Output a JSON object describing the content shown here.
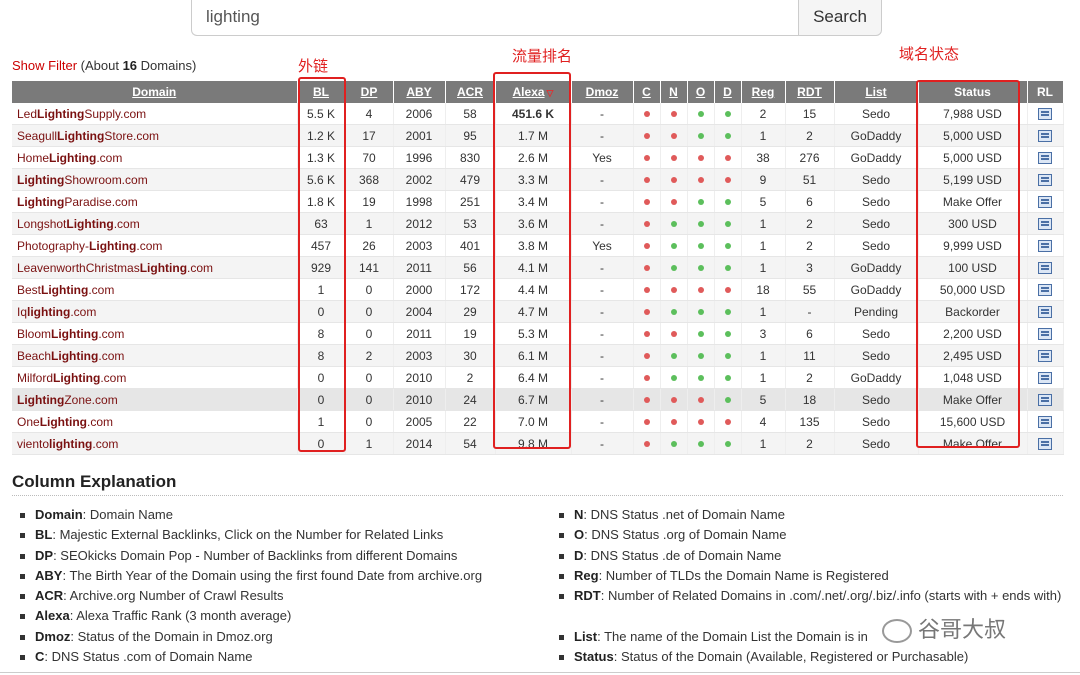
{
  "search": {
    "value": "lighting",
    "button_label": "Search"
  },
  "summary": {
    "show_filter": "Show Filter",
    "prefix": "(About ",
    "count": "16",
    "suffix": " Domains)"
  },
  "annotations": {
    "bl": "外链",
    "alexa": "流量排名",
    "status": "域名状态"
  },
  "columns": [
    "Domain",
    "BL",
    "DP",
    "ABY",
    "ACR",
    "Alexa",
    "Dmoz",
    "C",
    "N",
    "O",
    "D",
    "Reg",
    "RDT",
    "List",
    "Status",
    "RL"
  ],
  "rows": [
    {
      "pre": "Led",
      "kw": "Lighting",
      "post": "Supply.com",
      "bl": "5.5 K",
      "dp": "4",
      "aby": "2006",
      "acr": "58",
      "alexa": "451.6 K",
      "dmoz": "-",
      "c": "red",
      "n": "red",
      "o": "green",
      "d": "green",
      "reg": "2",
      "rdt": "15",
      "list": "Sedo",
      "status": "7,988 USD",
      "status_color": "green"
    },
    {
      "pre": "Seagull",
      "kw": "Lighting",
      "post": "Store.com",
      "bl": "1.2 K",
      "dp": "17",
      "aby": "2001",
      "acr": "95",
      "alexa": "1.7 M",
      "dmoz": "-",
      "c": "red",
      "n": "red",
      "o": "green",
      "d": "green",
      "reg": "1",
      "rdt": "2",
      "list": "GoDaddy",
      "status": "5,000 USD",
      "status_color": "orange"
    },
    {
      "pre": "Home",
      "kw": "Lighting",
      "post": ".com",
      "bl": "1.3 K",
      "dp": "70",
      "aby": "1996",
      "acr": "830",
      "alexa": "2.6 M",
      "dmoz": "Yes",
      "c": "red",
      "n": "red",
      "o": "red",
      "d": "red",
      "reg": "38",
      "rdt": "276",
      "list": "GoDaddy",
      "status": "5,000 USD",
      "status_color": "orange"
    },
    {
      "pre": "",
      "kw": "Lighting",
      "post": "Showroom.com",
      "bl": "5.6 K",
      "dp": "368",
      "aby": "2002",
      "acr": "479",
      "alexa": "3.3 M",
      "dmoz": "-",
      "c": "red",
      "n": "red",
      "o": "red",
      "d": "red",
      "reg": "9",
      "rdt": "51",
      "list": "Sedo",
      "status": "5,199 USD",
      "status_color": "orange"
    },
    {
      "pre": "",
      "kw": "Lighting",
      "post": "Paradise.com",
      "bl": "1.8 K",
      "dp": "19",
      "aby": "1998",
      "acr": "251",
      "alexa": "3.4 M",
      "dmoz": "-",
      "c": "red",
      "n": "red",
      "o": "green",
      "d": "green",
      "reg": "5",
      "rdt": "6",
      "list": "Sedo",
      "status": "Make Offer",
      "status_color": "orange"
    },
    {
      "pre": "Longshot",
      "kw": "Lighting",
      "post": ".com",
      "bl": "63",
      "dp": "1",
      "aby": "2012",
      "acr": "53",
      "alexa": "3.6 M",
      "dmoz": "-",
      "c": "red",
      "n": "green",
      "o": "green",
      "d": "green",
      "reg": "1",
      "rdt": "2",
      "list": "Sedo",
      "status": "300 USD",
      "status_color": "green"
    },
    {
      "pre": "Photography-",
      "kw": "Lighting",
      "post": ".com",
      "bl": "457",
      "dp": "26",
      "aby": "2003",
      "acr": "401",
      "alexa": "3.8 M",
      "dmoz": "Yes",
      "c": "red",
      "n": "green",
      "o": "green",
      "d": "green",
      "reg": "1",
      "rdt": "2",
      "list": "Sedo",
      "status": "9,999 USD",
      "status_color": "green"
    },
    {
      "pre": "LeavenworthChristmas",
      "kw": "Lighting",
      "post": ".com",
      "bl": "929",
      "dp": "141",
      "aby": "2011",
      "acr": "56",
      "alexa": "4.1 M",
      "dmoz": "-",
      "c": "red",
      "n": "green",
      "o": "green",
      "d": "green",
      "reg": "1",
      "rdt": "3",
      "list": "GoDaddy",
      "status": "100 USD",
      "status_color": "orange"
    },
    {
      "pre": "Best",
      "kw": "Lighting",
      "post": ".com",
      "bl": "1",
      "dp": "0",
      "aby": "2000",
      "acr": "172",
      "alexa": "4.4 M",
      "dmoz": "-",
      "c": "red",
      "n": "red",
      "o": "red",
      "d": "red",
      "reg": "18",
      "rdt": "55",
      "list": "GoDaddy",
      "status": "50,000 USD",
      "status_color": "orange"
    },
    {
      "pre": "Iq",
      "kw": "lighting",
      "post": ".com",
      "bl": "0",
      "dp": "0",
      "aby": "2004",
      "acr": "29",
      "alexa": "4.7 M",
      "dmoz": "-",
      "c": "red",
      "n": "green",
      "o": "green",
      "d": "green",
      "reg": "1",
      "rdt": "-",
      "list": "Pending",
      "status": "Backorder",
      "status_color": "plain"
    },
    {
      "pre": "Bloom",
      "kw": "Lighting",
      "post": ".com",
      "bl": "8",
      "dp": "0",
      "aby": "2011",
      "acr": "19",
      "alexa": "5.3 M",
      "dmoz": "-",
      "c": "red",
      "n": "red",
      "o": "green",
      "d": "green",
      "reg": "3",
      "rdt": "6",
      "list": "Sedo",
      "status": "2,200 USD",
      "status_color": "green"
    },
    {
      "pre": "Beach",
      "kw": "Lighting",
      "post": ".com",
      "bl": "8",
      "dp": "2",
      "aby": "2003",
      "acr": "30",
      "alexa": "6.1 M",
      "dmoz": "-",
      "c": "red",
      "n": "green",
      "o": "green",
      "d": "green",
      "reg": "1",
      "rdt": "11",
      "list": "Sedo",
      "status": "2,495 USD",
      "status_color": "orange"
    },
    {
      "pre": "Milford",
      "kw": "Lighting",
      "post": ".com",
      "bl": "0",
      "dp": "0",
      "aby": "2010",
      "acr": "2",
      "alexa": "6.4 M",
      "dmoz": "-",
      "c": "red",
      "n": "green",
      "o": "green",
      "d": "green",
      "reg": "1",
      "rdt": "2",
      "list": "GoDaddy",
      "status": "1,048 USD",
      "status_color": "green"
    },
    {
      "pre": "",
      "kw": "Lighting",
      "post": "Zone.com",
      "bl": "0",
      "dp": "0",
      "aby": "2010",
      "acr": "24",
      "alexa": "6.7 M",
      "dmoz": "-",
      "c": "red",
      "n": "red",
      "o": "red",
      "d": "green",
      "reg": "5",
      "rdt": "18",
      "list": "Sedo",
      "status": "Make Offer",
      "status_color": "orange"
    },
    {
      "pre": "One",
      "kw": "Lighting",
      "post": ".com",
      "bl": "1",
      "dp": "0",
      "aby": "2005",
      "acr": "22",
      "alexa": "7.0 M",
      "dmoz": "-",
      "c": "red",
      "n": "red",
      "o": "red",
      "d": "red",
      "reg": "4",
      "rdt": "135",
      "list": "Sedo",
      "status": "15,600 USD",
      "status_color": "green"
    },
    {
      "pre": "viento",
      "kw": "lighting",
      "post": ".com",
      "bl": "0",
      "dp": "1",
      "aby": "2014",
      "acr": "54",
      "alexa": "9.8 M",
      "dmoz": "-",
      "c": "red",
      "n": "green",
      "o": "green",
      "d": "green",
      "reg": "1",
      "rdt": "2",
      "list": "Sedo",
      "status": "Make Offer",
      "status_color": "orange"
    }
  ],
  "explanation": {
    "title": "Column Explanation",
    "left": [
      {
        "term": "Domain",
        "desc": ": Domain Name"
      },
      {
        "term": "BL",
        "desc": ": Majestic External Backlinks, Click on the Number for Related Links"
      },
      {
        "term": "DP",
        "desc": ": SEOkicks Domain Pop - Number of Backlinks from different Domains"
      },
      {
        "term": "ABY",
        "desc": ": The Birth Year of the Domain using the first found Date from archive.org"
      },
      {
        "term": "ACR",
        "desc": ": Archive.org Number of Crawl Results"
      },
      {
        "term": "Alexa",
        "desc": ": Alexa Traffic Rank (3 month average)"
      },
      {
        "term": "Dmoz",
        "desc": ": Status of the Domain in Dmoz.org"
      },
      {
        "term": "C",
        "desc": ": DNS Status .com of Domain Name"
      }
    ],
    "right": [
      {
        "term": "N",
        "desc": ": DNS Status .net of Domain Name"
      },
      {
        "term": "O",
        "desc": ": DNS Status .org of Domain Name"
      },
      {
        "term": "D",
        "desc": ": DNS Status .de of Domain Name"
      },
      {
        "term": "Reg",
        "desc": ": Number of TLDs the Domain Name is Registered"
      },
      {
        "term": "RDT",
        "desc": ": Number of Related Domains in .com/.net/.org/.biz/.info (starts with + ends with)"
      },
      {
        "term": "List",
        "desc": ": The name of the Domain List the Domain is in"
      },
      {
        "term": "Status",
        "desc": ": Status of the Domain (Available, Registered or Purchasable)"
      }
    ]
  },
  "watermark": "谷哥大叔"
}
